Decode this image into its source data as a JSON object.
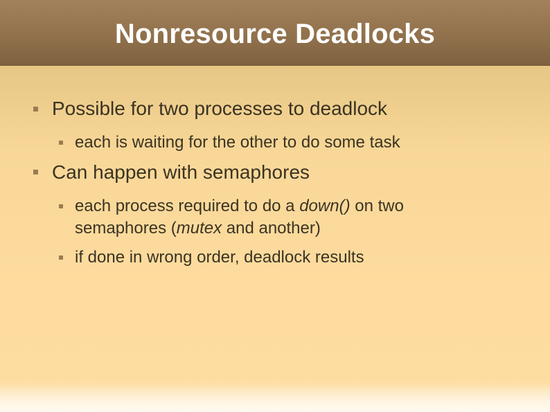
{
  "slide": {
    "title": "Nonresource Deadlocks",
    "bullets": {
      "b1": "Possible for two processes to deadlock",
      "b1_1": "each is waiting for the other to do some task",
      "b2": "Can happen with semaphores",
      "b2_1_part1": "each process required to do a ",
      "b2_1_italic1": "down()",
      "b2_1_part2": " on two",
      "b2_1_line2_part1": "semaphores (",
      "b2_1_italic2": "mutex",
      "b2_1_line2_part2": " and another)",
      "b2_2": "if done in wrong order, deadlock results"
    }
  }
}
